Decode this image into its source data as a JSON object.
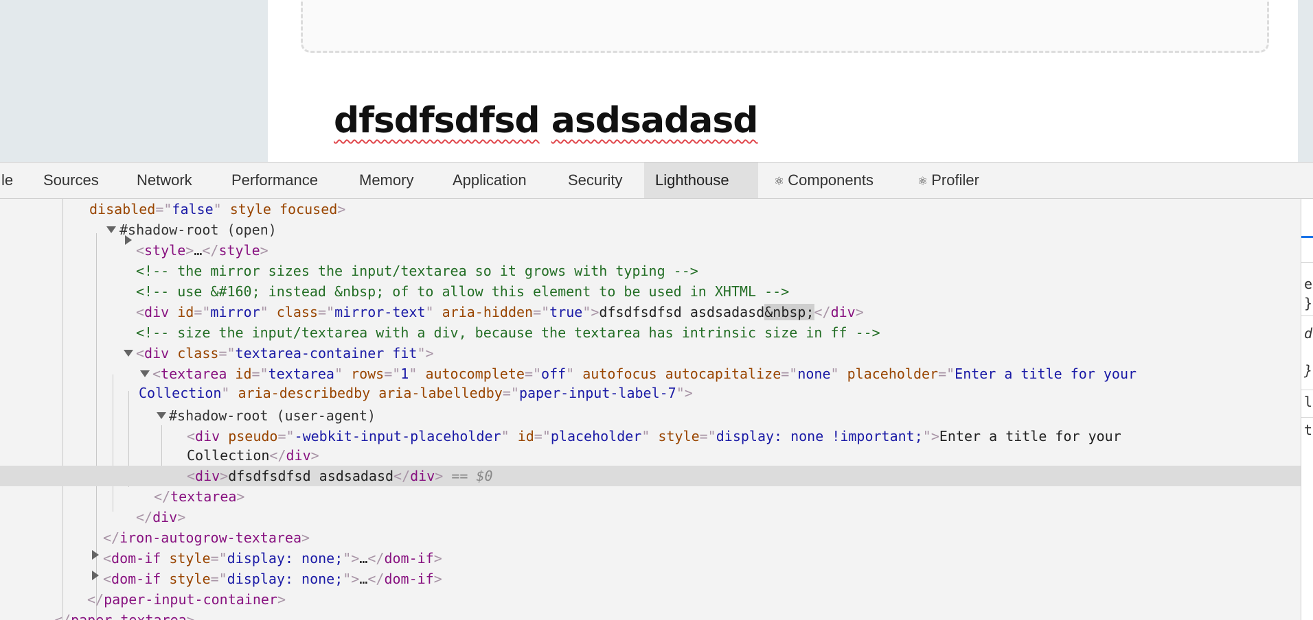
{
  "page": {
    "title_words": [
      "dfsdfsdfsd",
      "asdsadasd"
    ]
  },
  "devtools": {
    "tabs": [
      {
        "label": "le",
        "react": false
      },
      {
        "label": "Sources",
        "react": false
      },
      {
        "label": "Network",
        "react": false
      },
      {
        "label": "Performance",
        "react": false
      },
      {
        "label": "Memory",
        "react": false
      },
      {
        "label": "Application",
        "react": false
      },
      {
        "label": "Security",
        "react": false
      },
      {
        "label": "Lighthouse",
        "react": false,
        "active": true
      },
      {
        "label": "Components",
        "react": true
      },
      {
        "label": "Profiler",
        "react": true
      }
    ],
    "react_icon": "⚛",
    "elements": {
      "l0": {
        "attr1": "disabled",
        "val1": "false",
        "attr2": "style",
        "attr3": "focused"
      },
      "l1": {
        "text": "#shadow-root (open)"
      },
      "l2": {
        "tag": "style",
        "ellipsis": "…"
      },
      "l3": {
        "comment": "<!-- the mirror sizes the input/textarea so it grows with typing -->"
      },
      "l4": {
        "comment": "<!-- use &#160; instead &nbsp; of to allow this element to be used in XHTML -->"
      },
      "l5": {
        "tag": "div",
        "a1": "id",
        "v1": "mirror",
        "a2": "class",
        "v2": "mirror-text",
        "a3": "aria-hidden",
        "v3": "true",
        "text": "dfsdfsdfsd asdsadasd",
        "entity": "&nbsp;"
      },
      "l6": {
        "comment": "<!-- size the input/textarea with a div, because the textarea has intrinsic size in ff -->"
      },
      "l7": {
        "tag": "div",
        "a1": "class",
        "v1": "textarea-container fit"
      },
      "l8": {
        "tag": "textarea",
        "a1": "id",
        "v1": "textarea",
        "a2": "rows",
        "v2": "1",
        "a3": "autocomplete",
        "v3": "off",
        "a4": "autofocus",
        "a5": "autocapitalize",
        "v5": "none",
        "a6": "placeholder",
        "v6a": "Enter a title for your"
      },
      "l9": {
        "v6b": "Collection",
        "a7": "aria-describedby",
        "a8": "aria-labelledby",
        "v8": "paper-input-label-7"
      },
      "l10": {
        "text": "#shadow-root (user-agent)"
      },
      "l11": {
        "tag": "div",
        "a1": "pseudo",
        "v1": "-webkit-input-placeholder",
        "a2": "id",
        "v2": "placeholder",
        "a3": "style",
        "v3": "display: none !important;",
        "text": "Enter a title for your"
      },
      "l12": {
        "text": "Collection",
        "tag": "div"
      },
      "l13": {
        "tag": "div",
        "text": "dfsdfsdfsd asdsadasd",
        "eq": "== $0"
      },
      "l14": {
        "tag": "textarea"
      },
      "l15": {
        "tag": "div"
      },
      "l16": {
        "tag": "iron-autogrow-textarea"
      },
      "l17": {
        "tag": "dom-if",
        "a1": "style",
        "v1": "display: none;",
        "ellipsis": "…"
      },
      "l18": {
        "tag": "dom-if",
        "a1": "style",
        "v1": "display: none;",
        "ellipsis": "…"
      },
      "l19": {
        "tag": "paper-input-container"
      },
      "l20": {
        "tag": "paper-textarea"
      }
    },
    "sidebar_fragments": [
      "e",
      "}",
      "d",
      "}",
      "l",
      "t"
    ]
  }
}
